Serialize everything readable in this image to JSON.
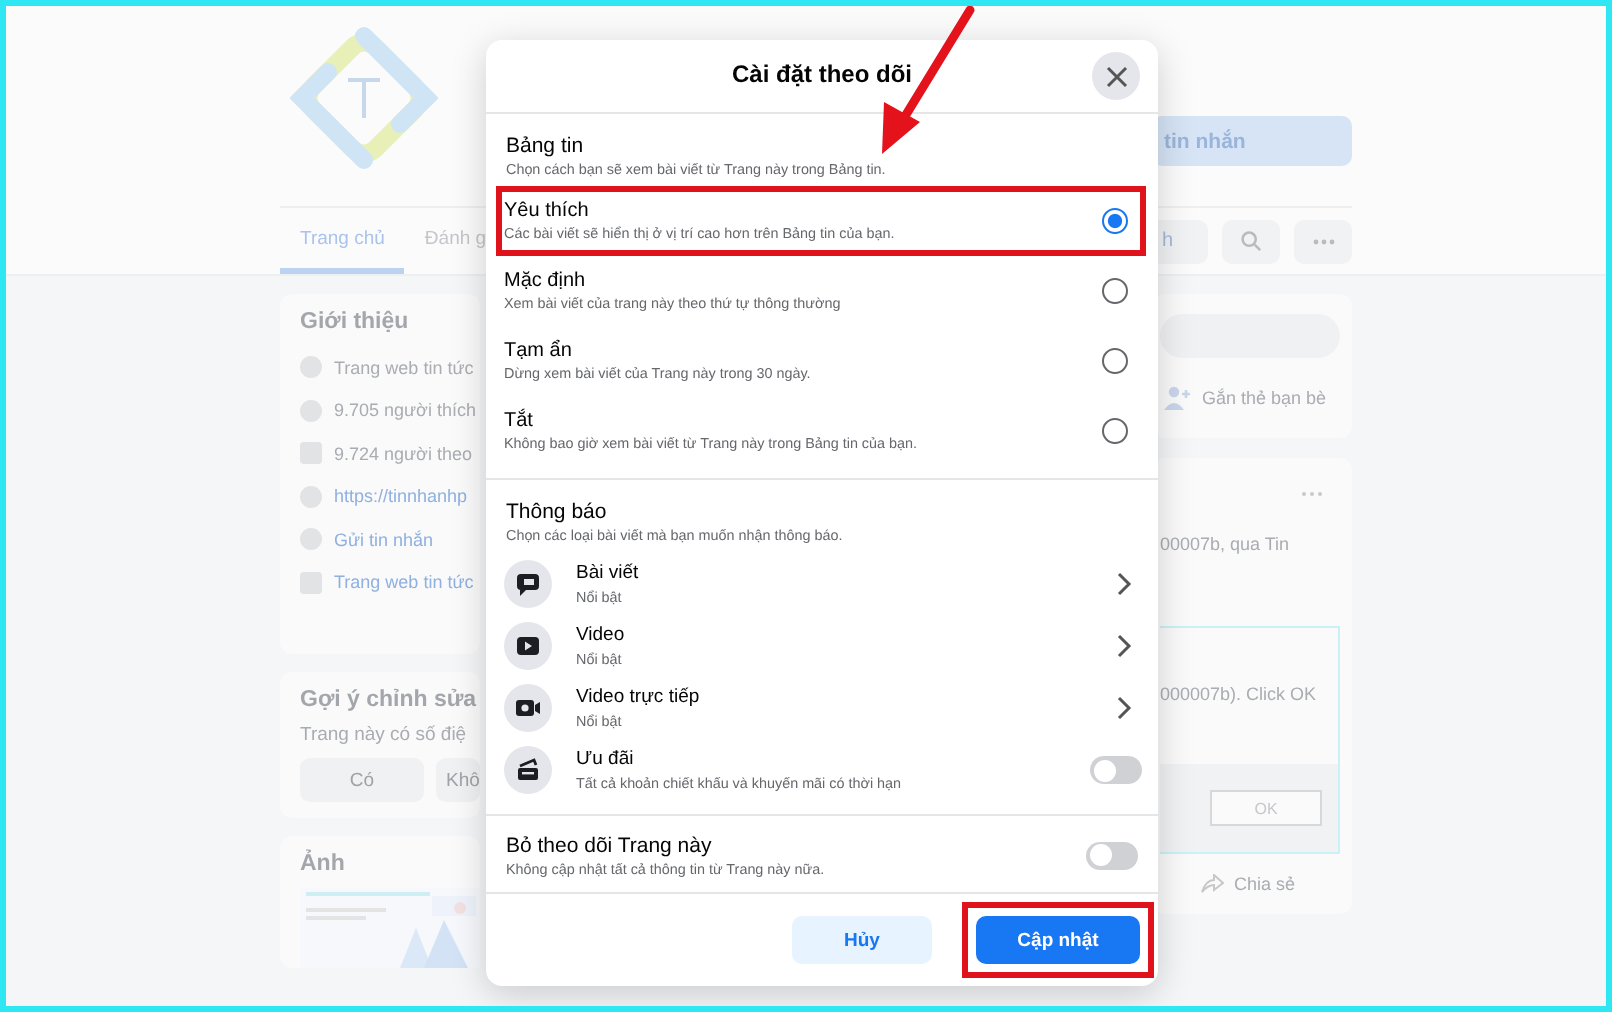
{
  "page": {
    "tabs": [
      {
        "label": "Trang chủ",
        "selected": true
      },
      {
        "label": "Đánh g",
        "selected": false
      }
    ],
    "message_button": "tin nhắn",
    "partial_button": "h",
    "intro": {
      "title": "Giới thiệu",
      "items": [
        {
          "kind": "info",
          "text": "Trang web tin tức"
        },
        {
          "kind": "like",
          "text": "9.705 người thích"
        },
        {
          "kind": "follow",
          "text": "9.724 người theo"
        },
        {
          "kind": "link",
          "text": "https://tinnhanhp"
        },
        {
          "kind": "messenger",
          "text": "Gửi tin nhắn"
        },
        {
          "kind": "category",
          "text": "Trang web tin tức"
        }
      ]
    },
    "edit_suggestion": {
      "title": "Gợi ý chỉnh sửa",
      "question": "Trang này có số điệ",
      "buttons": [
        "Có",
        "Khô"
      ]
    },
    "photos": {
      "title": "Ảnh"
    },
    "composer": {
      "tag_friends": "Gắn thẻ bạn bè"
    },
    "post": {
      "text": "00007b, qua Tin",
      "dialog_text": "000007b). Click OK",
      "ok_button": "OK",
      "share": "Chia sẻ"
    }
  },
  "dialog": {
    "title": "Cài đặt theo dõi",
    "feed": {
      "title": "Bảng tin",
      "description": "Chọn cách bạn sẽ xem bài viết từ Trang này trong Bảng tin.",
      "options": [
        {
          "label": "Yêu thích",
          "description": "Các bài viết sẽ hiển thị ở vị trí cao hơn trên Bảng tin của bạn.",
          "selected": true,
          "highlighted": true
        },
        {
          "label": "Mặc định",
          "description": "Xem bài viết của trang này theo thứ tự thông thường",
          "selected": false,
          "highlighted": false
        },
        {
          "label": "Tạm ẩn",
          "description": "Dừng xem bài viết của Trang này trong 30 ngày.",
          "selected": false,
          "highlighted": false
        },
        {
          "label": "Tắt",
          "description": "Không bao giờ xem bài viết từ Trang này trong Bảng tin của bạn.",
          "selected": false,
          "highlighted": false
        }
      ]
    },
    "notifications": {
      "title": "Thông báo",
      "description": "Chọn các loại bài viết mà bạn muốn nhận thông báo.",
      "items": [
        {
          "kind": "submenu",
          "label": "Bài viết",
          "sublabel": "Nổi bật"
        },
        {
          "kind": "submenu",
          "label": "Video",
          "sublabel": "Nổi bật"
        },
        {
          "kind": "submenu",
          "label": "Video trực tiếp",
          "sublabel": "Nổi bật"
        },
        {
          "kind": "toggle",
          "label": "Ưu đãi",
          "sublabel": "Tất cả khoản chiết khấu và khuyến mãi có thời hạn",
          "on": false
        }
      ]
    },
    "unfollow": {
      "title": "Bỏ theo dõi Trang này",
      "description": "Không cập nhật tất cả thông tin từ Trang này nữa.",
      "on": false
    },
    "buttons": [
      {
        "kind": "secondary",
        "label": "Hủy",
        "highlighted": false
      },
      {
        "kind": "primary",
        "label": "Cập nhật",
        "highlighted": true
      }
    ]
  }
}
